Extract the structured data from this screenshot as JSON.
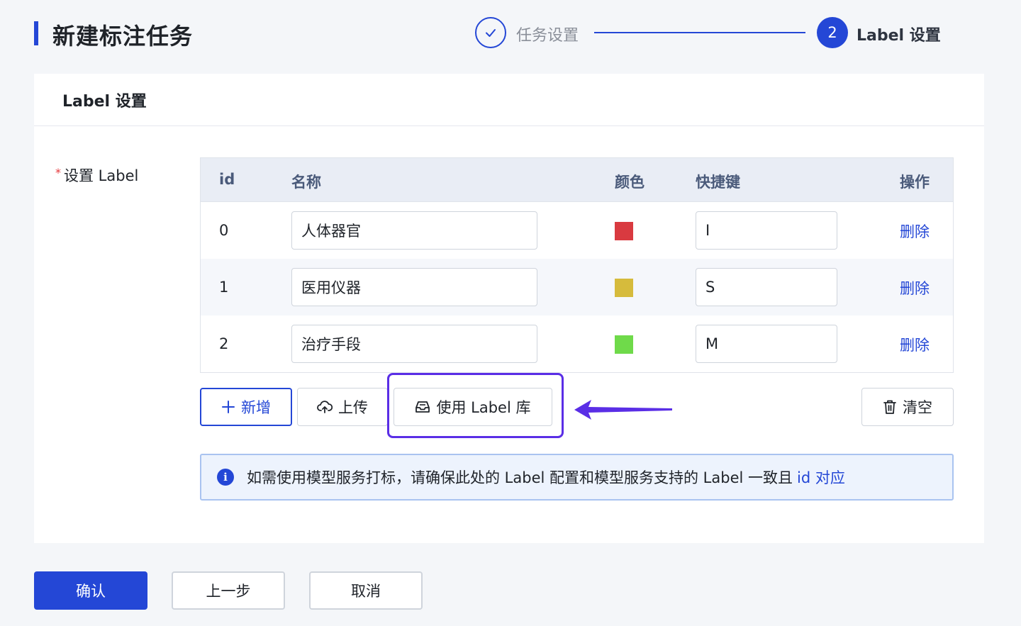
{
  "page": {
    "title": "新建标注任务"
  },
  "steps": [
    {
      "label": "任务设置",
      "status": "done"
    },
    {
      "number": "2",
      "label": "Label 设置",
      "status": "active"
    }
  ],
  "card": {
    "title": "Label 设置",
    "field_label": "设置 Label",
    "required_mark": "*"
  },
  "table": {
    "headers": {
      "id": "id",
      "name": "名称",
      "color": "颜色",
      "shortcut": "快捷键",
      "action": "操作"
    },
    "rows": [
      {
        "id": "0",
        "name": "人体器官",
        "color": "#d93a40",
        "shortcut": "I",
        "action": "删除"
      },
      {
        "id": "1",
        "name": "医用仪器",
        "color": "#d6bb3c",
        "shortcut": "S",
        "action": "删除"
      },
      {
        "id": "2",
        "name": "治疗手段",
        "color": "#6fda4a",
        "shortcut": "M",
        "action": "删除"
      }
    ]
  },
  "actions": {
    "add": "新增",
    "upload": "上传",
    "use_library": "使用 Label 库",
    "clear": "清空"
  },
  "alert": {
    "text": "如需使用模型服务打标，请确保此处的 Label 配置和模型服务支持的 Label 一致且",
    "link": "id 对应"
  },
  "footer": {
    "confirm": "确认",
    "prev": "上一步",
    "cancel": "取消"
  },
  "colors": {
    "accent": "#2447d6",
    "highlight": "#5a2ee6"
  }
}
